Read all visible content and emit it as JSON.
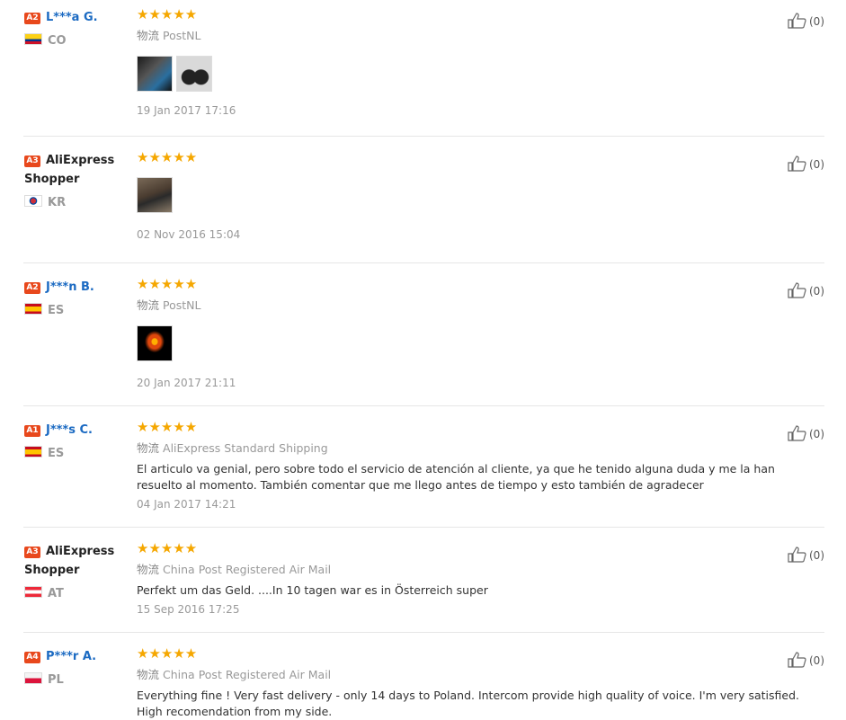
{
  "reviews": [
    {
      "level": "A2",
      "username": "L***a G.",
      "country": "CO",
      "stars": "★★★★★",
      "logistics_zh": "物流",
      "logistics": "PostNL",
      "text": "",
      "date": "19 Jan 2017 17:16",
      "helpful": "(0)"
    },
    {
      "level": "A3",
      "username": "AliExpress Shopper",
      "country": "KR",
      "stars": "★★★★★",
      "logistics_zh": "",
      "logistics": "",
      "text": "",
      "date": "02 Nov 2016 15:04",
      "helpful": "(0)"
    },
    {
      "level": "A2",
      "username": "J***n B.",
      "country": "ES",
      "stars": "★★★★★",
      "logistics_zh": "物流",
      "logistics": "PostNL",
      "text": "",
      "date": "20 Jan 2017 21:11",
      "helpful": "(0)"
    },
    {
      "level": "A1",
      "username": "J***s C.",
      "country": "ES",
      "stars": "★★★★★",
      "logistics_zh": "物流",
      "logistics": "AliExpress Standard Shipping",
      "text": "El articulo va genial, pero sobre todo el servicio de atención al cliente, ya que he tenido alguna duda y me la han resuelto al momento. También comentar que me llego antes de tiempo y esto también de agradecer",
      "date": "04 Jan 2017 14:21",
      "helpful": "(0)"
    },
    {
      "level": "A3",
      "username": "AliExpress Shopper",
      "country": "AT",
      "stars": "★★★★★",
      "logistics_zh": "物流",
      "logistics": "China Post Registered Air Mail",
      "text": "Perfekt um das Geld. ....In 10 tagen war es in Österreich super",
      "date": "15 Sep 2016 17:25",
      "helpful": "(0)"
    },
    {
      "level": "A4",
      "username": "P***r A.",
      "country": "PL",
      "stars": "★★★★★",
      "logistics_zh": "物流",
      "logistics": "China Post Registered Air Mail",
      "text": "Everything fine ! Very fast delivery - only 14 days to Poland. Intercom provide high quality of voice. I'm very satisfied. High recomendation from my side.",
      "date": "",
      "helpful": "(0)"
    }
  ]
}
